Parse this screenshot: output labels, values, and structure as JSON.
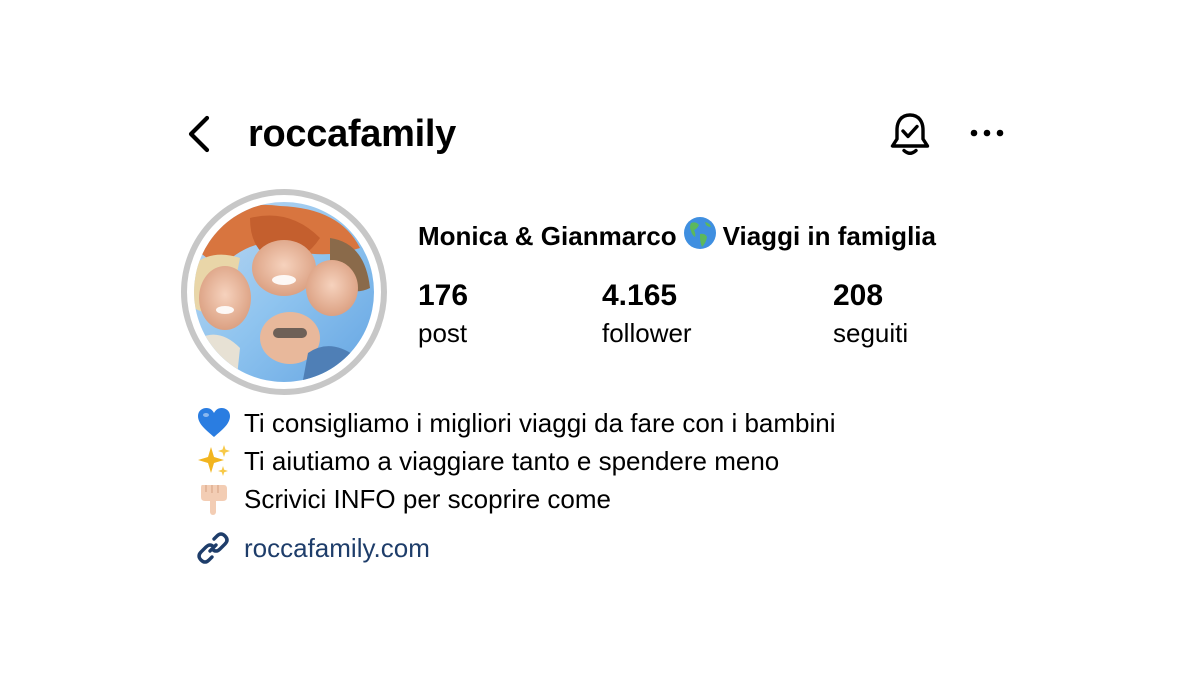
{
  "header": {
    "username": "roccafamily",
    "back_icon": "chevron-left-icon",
    "notify_icon": "bell-check-icon",
    "more_icon": "more-horizontal-icon"
  },
  "profile": {
    "avatar_icon": "profile-photo",
    "display_name_part1": "Monica & Gianmarco",
    "display_name_emoji": "globe-americas-icon",
    "display_name_part2": "Viaggi in famiglia"
  },
  "stats": [
    {
      "count": "176",
      "label": "post"
    },
    {
      "count": "4.165",
      "label": "follower"
    },
    {
      "count": "208",
      "label": "seguiti"
    }
  ],
  "bio": [
    {
      "emoji": "blue-heart-icon",
      "text": "Ti consigliamo i migliori viaggi da fare con i bambini"
    },
    {
      "emoji": "sparkles-icon",
      "text": "Ti aiutiamo a viaggiare tanto e spendere meno"
    },
    {
      "emoji": "pointing-down-hand-icon",
      "text": "Scrivici INFO per scoprire come"
    }
  ],
  "link": {
    "icon": "link-icon",
    "text": "roccafamily.com"
  },
  "colors": {
    "link": "#1e3d6a",
    "avatar_ring": "#c7c7c7",
    "sky": "#8fc4ef"
  }
}
